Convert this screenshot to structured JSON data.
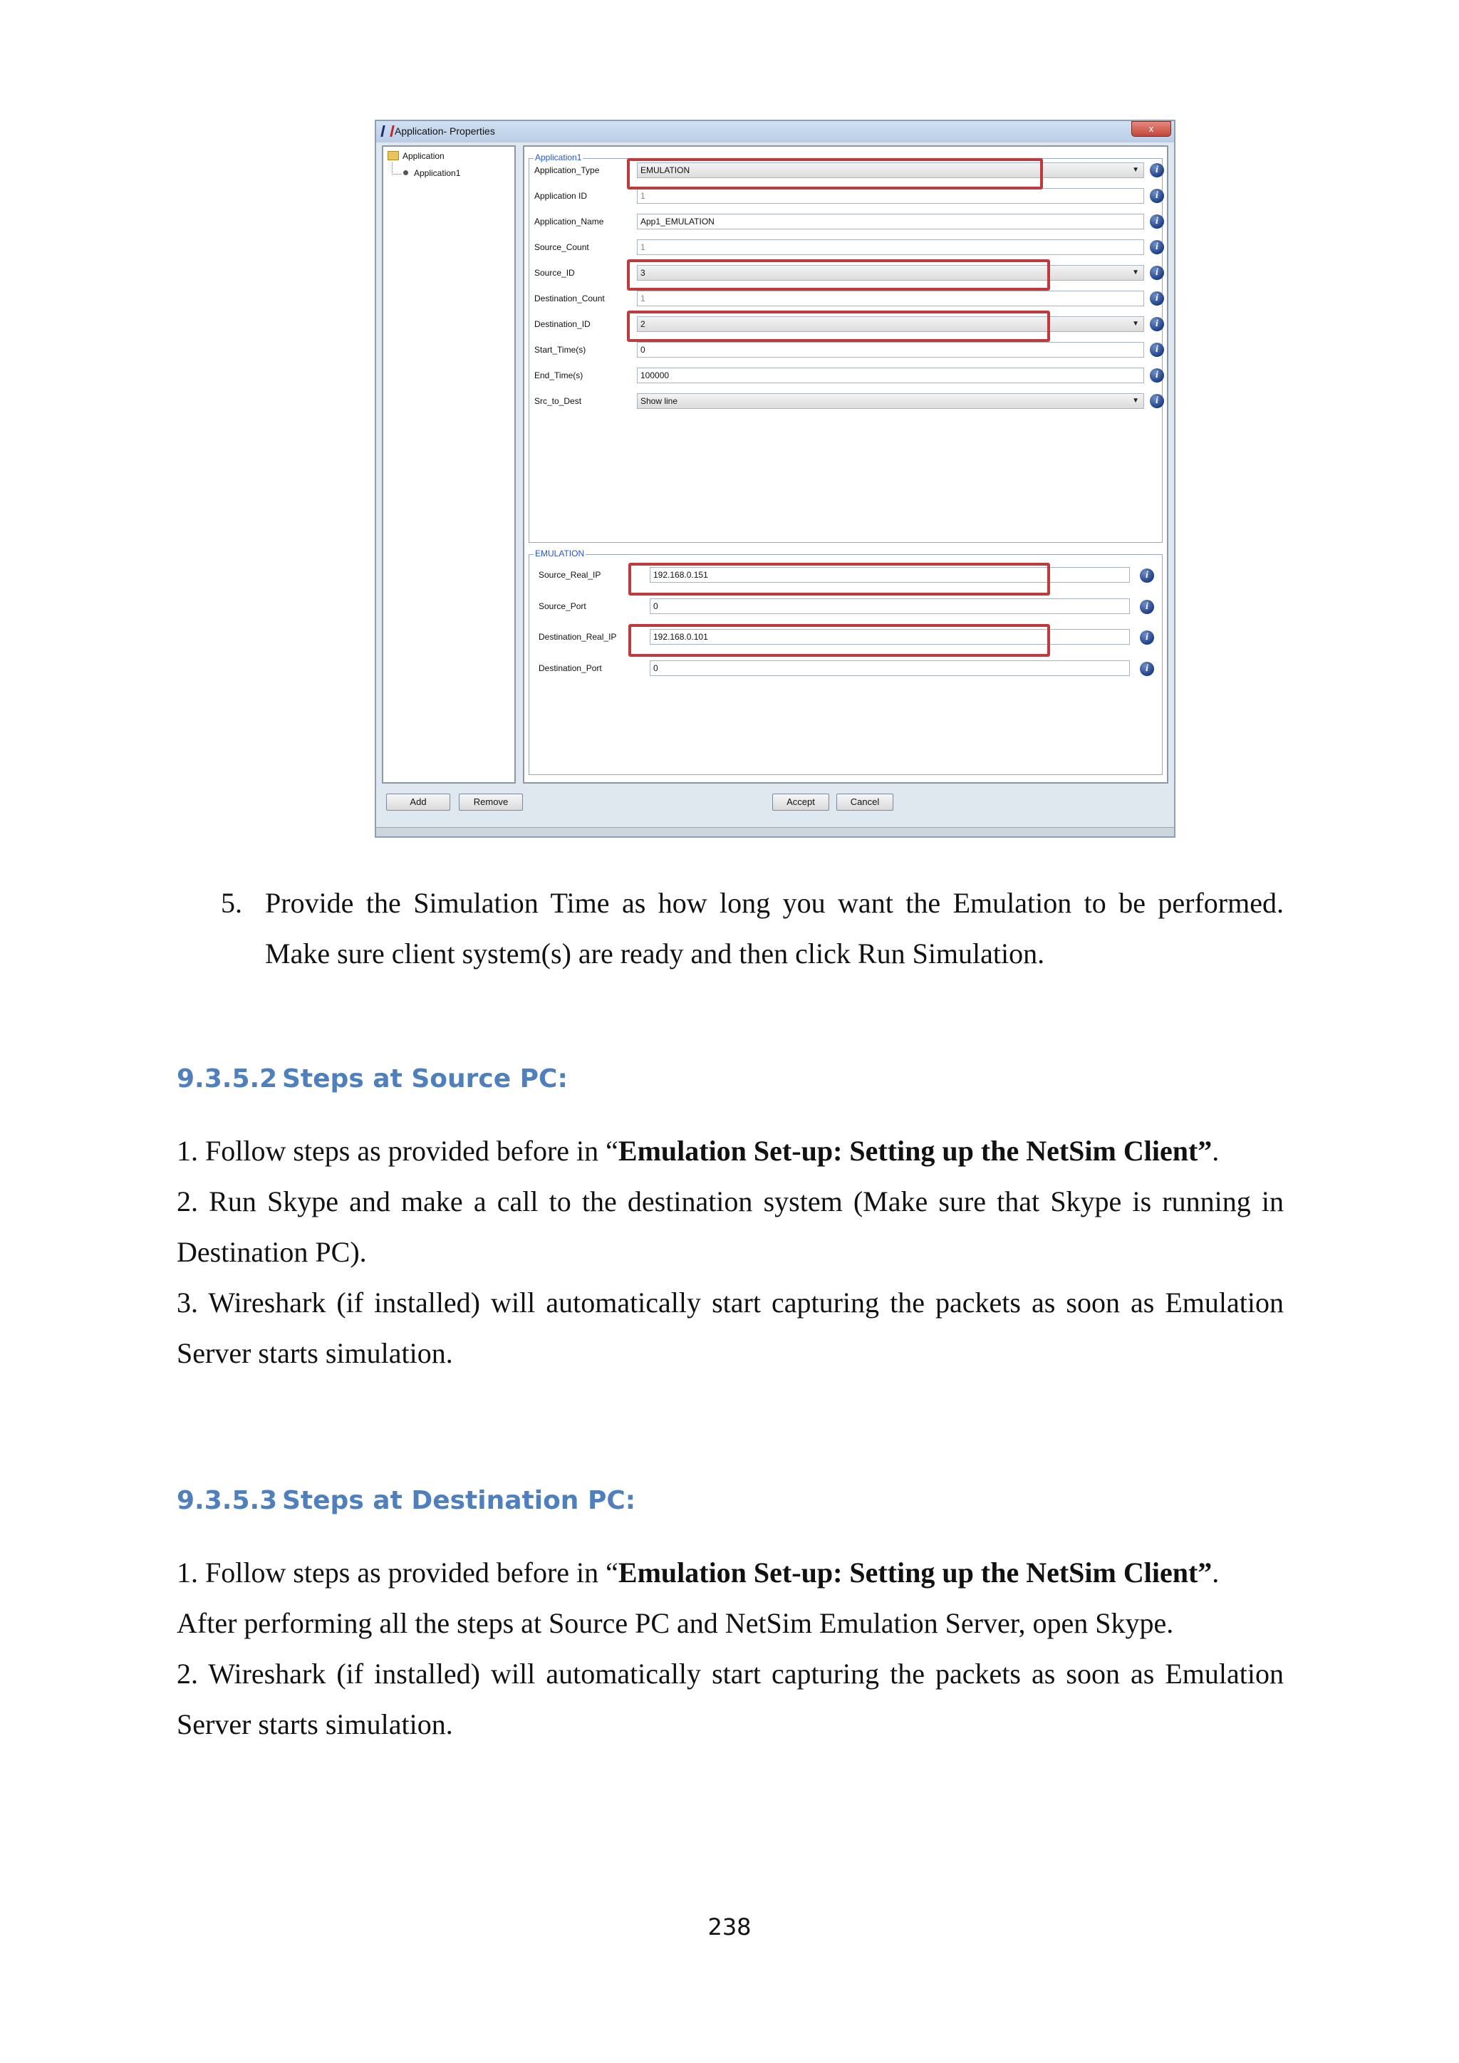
{
  "dialog": {
    "title": "Application- Properties",
    "close": "x",
    "tree": {
      "root": "Application",
      "child": "Application1"
    },
    "section1_title": "Application1",
    "rows": [
      {
        "label": "Application_Type",
        "value": "EMULATION",
        "type": "select"
      },
      {
        "label": "Application ID",
        "value": "1",
        "type": "disabled"
      },
      {
        "label": "Application_Name",
        "value": "App1_EMULATION",
        "type": "text"
      },
      {
        "label": "Source_Count",
        "value": "1",
        "type": "disabled"
      },
      {
        "label": "Source_ID",
        "value": "3",
        "type": "select"
      },
      {
        "label": "Destination_Count",
        "value": "1",
        "type": "disabled"
      },
      {
        "label": "Destination_ID",
        "value": "2",
        "type": "select"
      },
      {
        "label": "Start_Time(s)",
        "value": "0",
        "type": "text"
      },
      {
        "label": "End_Time(s)",
        "value": "100000",
        "type": "text"
      },
      {
        "label": "Src_to_Dest",
        "value": "Show line",
        "type": "select"
      }
    ],
    "section2_title": "EMULATION",
    "emu_rows": [
      {
        "label": "Source_Real_IP",
        "value": "192.168.0.151"
      },
      {
        "label": "Source_Port",
        "value": "0"
      },
      {
        "label": "Destination_Real_IP",
        "value": "192.168.0.101"
      },
      {
        "label": "Destination_Port",
        "value": "0"
      }
    ],
    "buttons": {
      "add": "Add",
      "remove": "Remove",
      "accept": "Accept",
      "cancel": "Cancel"
    }
  },
  "step5": {
    "number": "5.",
    "line1": "Provide the Simulation Time as how long you want the Emulation to be performed.",
    "line2": "Make sure client system(s) are ready and then click Run Simulation."
  },
  "section_source": {
    "number": "9.3.5.2",
    "title": "Steps at Source PC:",
    "p1_pre": "1. Follow steps as provided before in “",
    "p1_bold": "Emulation Set-up: Setting up the NetSim Client”",
    "p1_post": ".",
    "p2_line1": "2. Run Skype and make a call to the destination system (Make sure that Skype is running in",
    "p2_line2": "Destination PC).",
    "p3_line1": "3. Wireshark (if installed) will automatically start capturing the packets as soon as Emulation",
    "p3_line2": "Server starts simulation."
  },
  "section_dest": {
    "number": "9.3.5.3",
    "title": "Steps at Destination PC:",
    "p1_pre": "1.  Follow steps as provided before in “",
    "p1_bold": "Emulation Set-up: Setting up the NetSim Client”",
    "p1_post": ".",
    "p1_line2": "After performing all the steps at Source PC and NetSim Emulation Server, open Skype.",
    "p2_line1": "2. Wireshark (if installed) will automatically start capturing the packets as soon as Emulation",
    "p2_line2": "Server starts simulation."
  },
  "page_number": "238"
}
